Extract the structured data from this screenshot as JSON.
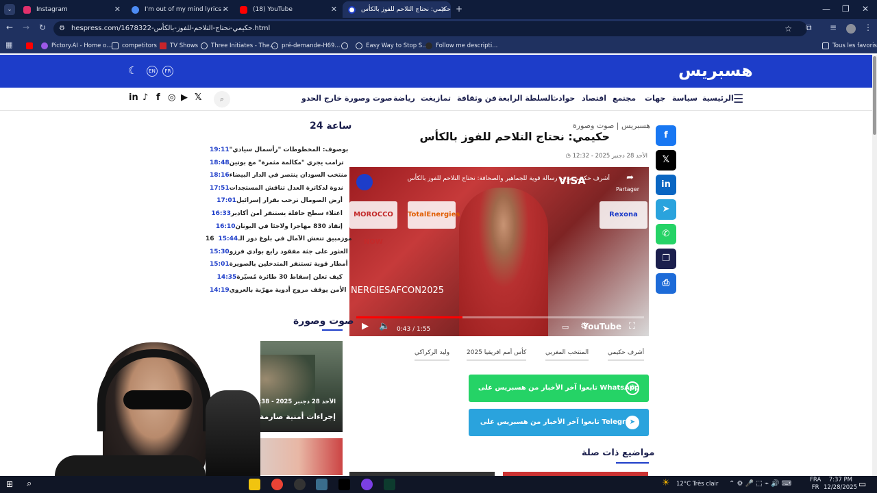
{
  "browser": {
    "tabs": [
      {
        "label": "Instagram",
        "icon": "instagram-icon",
        "color": "#e1306c"
      },
      {
        "label": "I'm out of my mind lyrics - Reci",
        "icon": "globe-icon",
        "color": "#4d8cf5"
      },
      {
        "label": "(18) YouTube",
        "icon": "youtube-icon",
        "color": "#ff0000"
      },
      {
        "label": "حكيمي: نحتاج التلاحم للفوز بالكأس",
        "icon": "hespress-icon",
        "color": "#1d3dc9"
      }
    ],
    "url": "hespress.com/1678322-حكيمي-نحتاج-التلاحم-للفوز-بالكأس.html",
    "bookmarks": [
      {
        "label": "",
        "icon": "youtube-icon"
      },
      {
        "label": "Pictory.AI - Home o...",
        "icon": "pictory-icon"
      },
      {
        "label": "competitors",
        "icon": "folder-icon"
      },
      {
        "label": "TV Shows",
        "icon": "bookmark-icon"
      },
      {
        "label": "Three Initiates - The...",
        "icon": "globe-icon"
      },
      {
        "label": "pré-demande-H69...",
        "icon": "globe-icon"
      },
      {
        "label": "",
        "icon": "globe-icon"
      },
      {
        "label": "Easy Way to Stop S...",
        "icon": "globe-icon"
      },
      {
        "label": "Follow me descripti...",
        "icon": "globe-icon"
      },
      {
        "label": "Tous les favoris",
        "icon": "folder-icon"
      }
    ]
  },
  "site": {
    "logo": "هسبريس",
    "lang_en": "EN",
    "lang_fr": "FR",
    "brand_color": "#1d3dc9",
    "menu": [
      "الرئيسية",
      "سياسة",
      "جهات",
      "مجتمع",
      "اقتصاد",
      "حوادث",
      "السلطة الرابعة",
      "فن وثقافة",
      "تمازيغت",
      "رياضة",
      "صوت وصورة",
      "خارج الحدو"
    ]
  },
  "article": {
    "category": "هسبريس | صوت وصورة",
    "title": "حكيمي: نحتاج التلاحم للفوز بالكأس",
    "date": "الأحد 28 دجنبر 2025 - 12:32",
    "video": {
      "title": "أشرف حكيمي يوجه رسالة قوية للجماهير والصحافة: نحتاج التلاحم للفوز بالكأس",
      "share_label": "Partager",
      "banner": "NERGIESAFCON2025",
      "time": "0:43 / 1:55",
      "progress": 0.37,
      "youtube_label": "YouTube",
      "logos": [
        "MOROCCO NOW",
        "TotalEnergies",
        "VISA",
        "Rexona"
      ]
    },
    "tags": [
      "أشرف حكيمي",
      "المنتخب المغربي",
      "كأس أمم افريقيا 2025",
      "وليد الركراكي"
    ],
    "follow_whatsapp": "تابعوا آخر الأخبار من هسبريس على WhatsApp",
    "follow_telegram": "تابعوا آخر الأخبار من هسبريس على Telegram",
    "related_title": "مواضيع ذات صلة"
  },
  "sidebar": {
    "title": "24 ساعة",
    "news": [
      {
        "time": "19:11",
        "text": "بوصوف: المخطوطات \"رأسمال سيادي\""
      },
      {
        "time": "18:48",
        "text": "ترامب يجري \"مكالمة مثمرة\" مع بوتين"
      },
      {
        "time": "18:16",
        "text": "منتخب السودان ينتصر في الدار البيضاء"
      },
      {
        "time": "17:51",
        "text": "ندوة لدكاترة العدل تناقش المستجدات"
      },
      {
        "time": "17:01",
        "text": "أرض الصومال ترحب بقرار إسرائيل"
      },
      {
        "time": "16:33",
        "text": "اعتلاء سطح حافلة يستنفر أمن أكادير"
      },
      {
        "time": "16:10",
        "text": "إنقاذ 830 مهاجرا ولاجئا في اليونان"
      },
      {
        "time": "15:44",
        "text": "موزمبيق تنعش الآمال في بلوغ دور الـ16"
      },
      {
        "time": "15:30",
        "text": "العثور على جثة مفقود رابع بوادي فرزو"
      },
      {
        "time": "15:01",
        "text": "أمطار قوية تستنفر المتدخلين بالصويرة"
      },
      {
        "time": "14:35",
        "text": "كيف تعلن إسقاط 30 طائرة مُسيّرة"
      },
      {
        "time": "14:19",
        "text": "الأمن يوقف مروج أدوية مهرّبة بالعروي"
      }
    ],
    "section2_title": "صوت وصورة",
    "card_date": "الأحد 28 دجنبر 2025 - 14:38 - 3",
    "card_title": "إجراءات أمنية صارمة بأكادير"
  },
  "taskbar": {
    "weather": "12°C Très clair",
    "lang1": "FRA",
    "lang2": "FR",
    "time": "7:37 PM",
    "date": "12/28/2025"
  }
}
